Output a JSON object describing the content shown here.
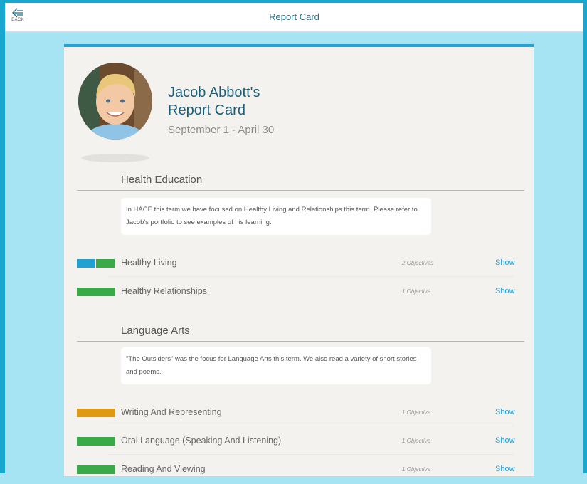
{
  "topbar": {
    "back_label": "BACK",
    "title": "Report Card"
  },
  "student": {
    "name_line1": "Jacob Abbott's",
    "name_line2": "Report Card",
    "dates": "September 1 - April 30"
  },
  "colors": {
    "frame": "#19a6cf",
    "background": "#a6e4f4",
    "accent": "#23a3d5",
    "green": "#3aaa48",
    "blue": "#1fa2d2",
    "orange": "#dd9a12"
  },
  "sections": [
    {
      "title": "Health Education",
      "note": "In HACE this term we have focused on Healthy Living and Relationships this term. Please refer to Jacob's portfolio to see examples of his learning.",
      "rows": [
        {
          "label": "Healthy Living",
          "objectives": "2 Objectives",
          "show": "Show",
          "bar": [
            "blue",
            "green"
          ]
        },
        {
          "label": "Healthy Relationships",
          "objectives": "1 Objective",
          "show": "Show",
          "bar": [
            "green"
          ]
        }
      ]
    },
    {
      "title": "Language Arts",
      "note": "\"The Outsiders\" was the focus for Language Arts this term. We also read a variety of short stories and poems.",
      "rows": [
        {
          "label": "Writing And Representing",
          "objectives": "1 Objective",
          "show": "Show",
          "bar": [
            "orange"
          ]
        },
        {
          "label": "Oral Language (Speaking And Listening)",
          "objectives": "1 Objective",
          "show": "Show",
          "bar": [
            "green"
          ]
        },
        {
          "label": "Reading And Viewing",
          "objectives": "1 Objective",
          "show": "Show",
          "bar": [
            "green"
          ]
        }
      ]
    }
  ]
}
